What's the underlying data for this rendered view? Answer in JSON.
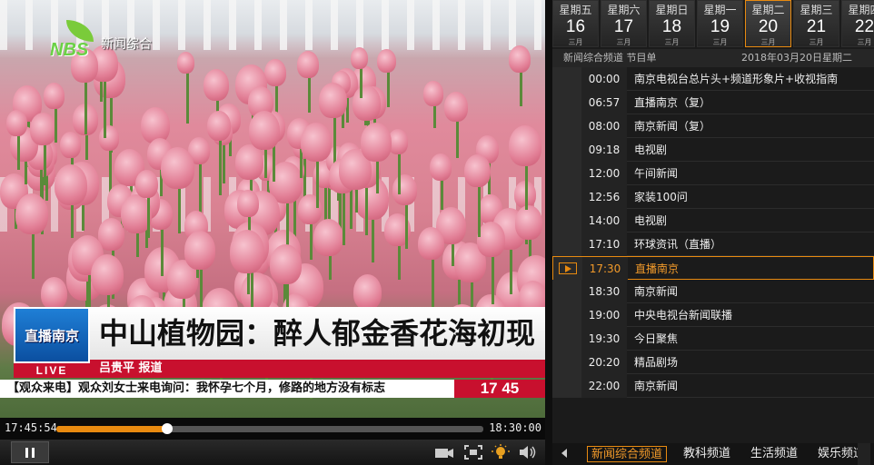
{
  "video": {
    "logo_text": "新闻综合",
    "logo_brand": "NBS",
    "badge": "直播南京",
    "live_label": "LIVE",
    "headline": "中山植物园：醉人郁金香花海初现",
    "reporter": "吕贵平 报道",
    "ticker": "【观众来电】观众刘女士来电询问：我怀孕七个月，修路的地方没有标志",
    "clock": "17 45"
  },
  "player": {
    "current_time": "17:45:54",
    "duration": "18:30:00",
    "progress": 0.26
  },
  "epg": {
    "days": [
      {
        "name": "星期五",
        "date": "16",
        "month": "三月"
      },
      {
        "name": "星期六",
        "date": "17",
        "month": "三月"
      },
      {
        "name": "星期日",
        "date": "18",
        "month": "三月"
      },
      {
        "name": "星期一",
        "date": "19",
        "month": "三月"
      },
      {
        "name": "星期二",
        "date": "20",
        "month": "三月",
        "active": true
      },
      {
        "name": "星期三",
        "date": "21",
        "month": "三月"
      },
      {
        "name": "星期四",
        "date": "22",
        "month": "三月"
      }
    ],
    "header_left": "新闻综合频道 节目单",
    "header_right": "2018年03月20日星期二",
    "programs": [
      {
        "time": "00:00",
        "name": "南京电视台总片头+频道形象片+收视指南"
      },
      {
        "time": "06:57",
        "name": "直播南京（复）"
      },
      {
        "time": "08:00",
        "name": "南京新闻（复）"
      },
      {
        "time": "09:18",
        "name": "电视剧"
      },
      {
        "time": "12:00",
        "name": "午间新闻"
      },
      {
        "time": "12:56",
        "name": "家装100问"
      },
      {
        "time": "14:00",
        "name": "电视剧"
      },
      {
        "time": "17:10",
        "name": "环球资讯（直播）"
      },
      {
        "time": "17:30",
        "name": "直播南京",
        "active": true
      },
      {
        "time": "18:30",
        "name": "南京新闻"
      },
      {
        "time": "19:00",
        "name": "中央电视台新闻联播"
      },
      {
        "time": "19:30",
        "name": "今日聚焦"
      },
      {
        "time": "20:20",
        "name": "精品剧场"
      },
      {
        "time": "22:00",
        "name": "南京新闻"
      }
    ],
    "channels": [
      {
        "name": "新闻综合频道",
        "active": true
      },
      {
        "name": "教科频道"
      },
      {
        "name": "生活频道"
      },
      {
        "name": "娱乐频道"
      }
    ]
  },
  "icons": {
    "pause": "pause-icon",
    "camera": "camera-icon",
    "fullscreen": "fullscreen-icon",
    "brightness": "lightbulb-icon",
    "volume": "volume-icon"
  },
  "colors": {
    "accent": "#e88a10",
    "live_red": "#c8102e",
    "badge_blue": "#1f7fd6"
  }
}
